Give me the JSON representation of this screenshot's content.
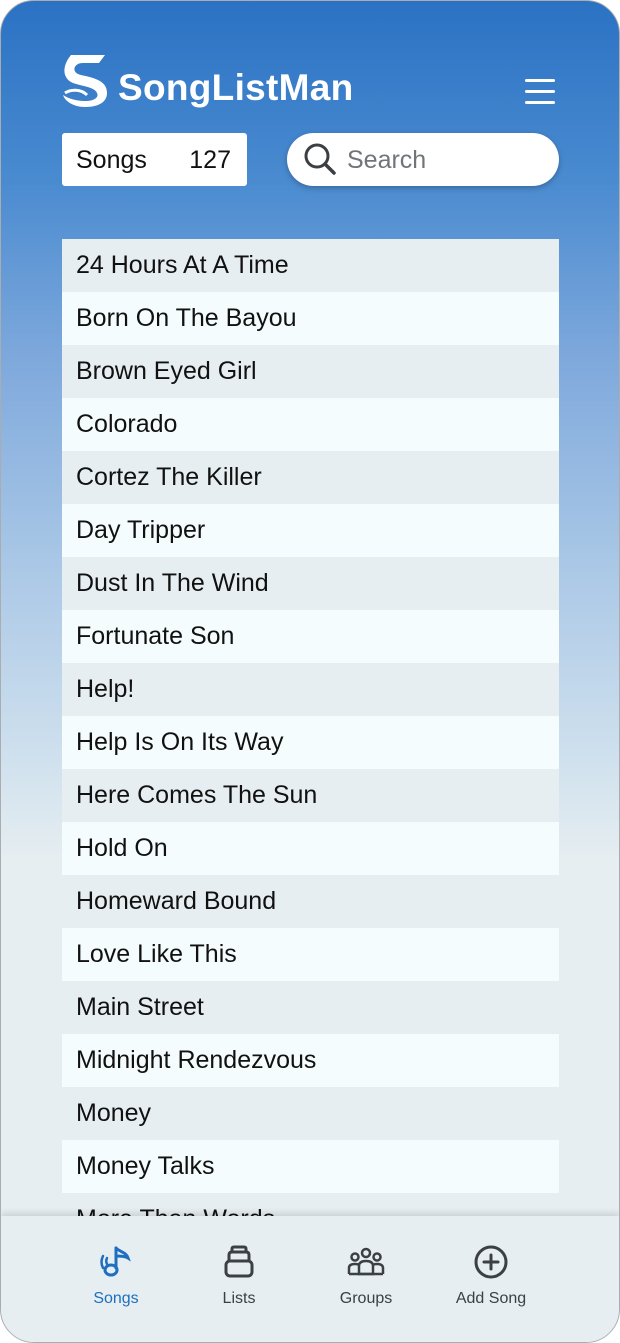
{
  "app": {
    "title": "SongListMan"
  },
  "header": {
    "songs_label": "Songs",
    "songs_count": "127",
    "search_placeholder": "Search"
  },
  "songs": [
    "24 Hours At A Time",
    "Born On The Bayou",
    "Brown Eyed Girl",
    "Colorado",
    "Cortez The Killer",
    "Day Tripper",
    "Dust In The Wind",
    "Fortunate Son",
    "Help!",
    "Help Is On Its Way",
    "Here Comes The Sun",
    "Hold On",
    "Homeward Bound",
    "Love Like This",
    "Main Street",
    "Midnight Rendezvous",
    "Money",
    "Money Talks",
    "More Than Words"
  ],
  "tabs": [
    {
      "label": "Songs",
      "icon": "music-note-icon",
      "active": true
    },
    {
      "label": "Lists",
      "icon": "stack-icon",
      "active": false
    },
    {
      "label": "Groups",
      "icon": "group-icon",
      "active": false
    },
    {
      "label": "Add Song",
      "icon": "add-circle-icon",
      "active": false
    }
  ],
  "colors": {
    "accent": "#1e6fc0",
    "header_top": "#2b72c4",
    "row_alt": "#e6eef1",
    "row": "#f5fcfd"
  }
}
